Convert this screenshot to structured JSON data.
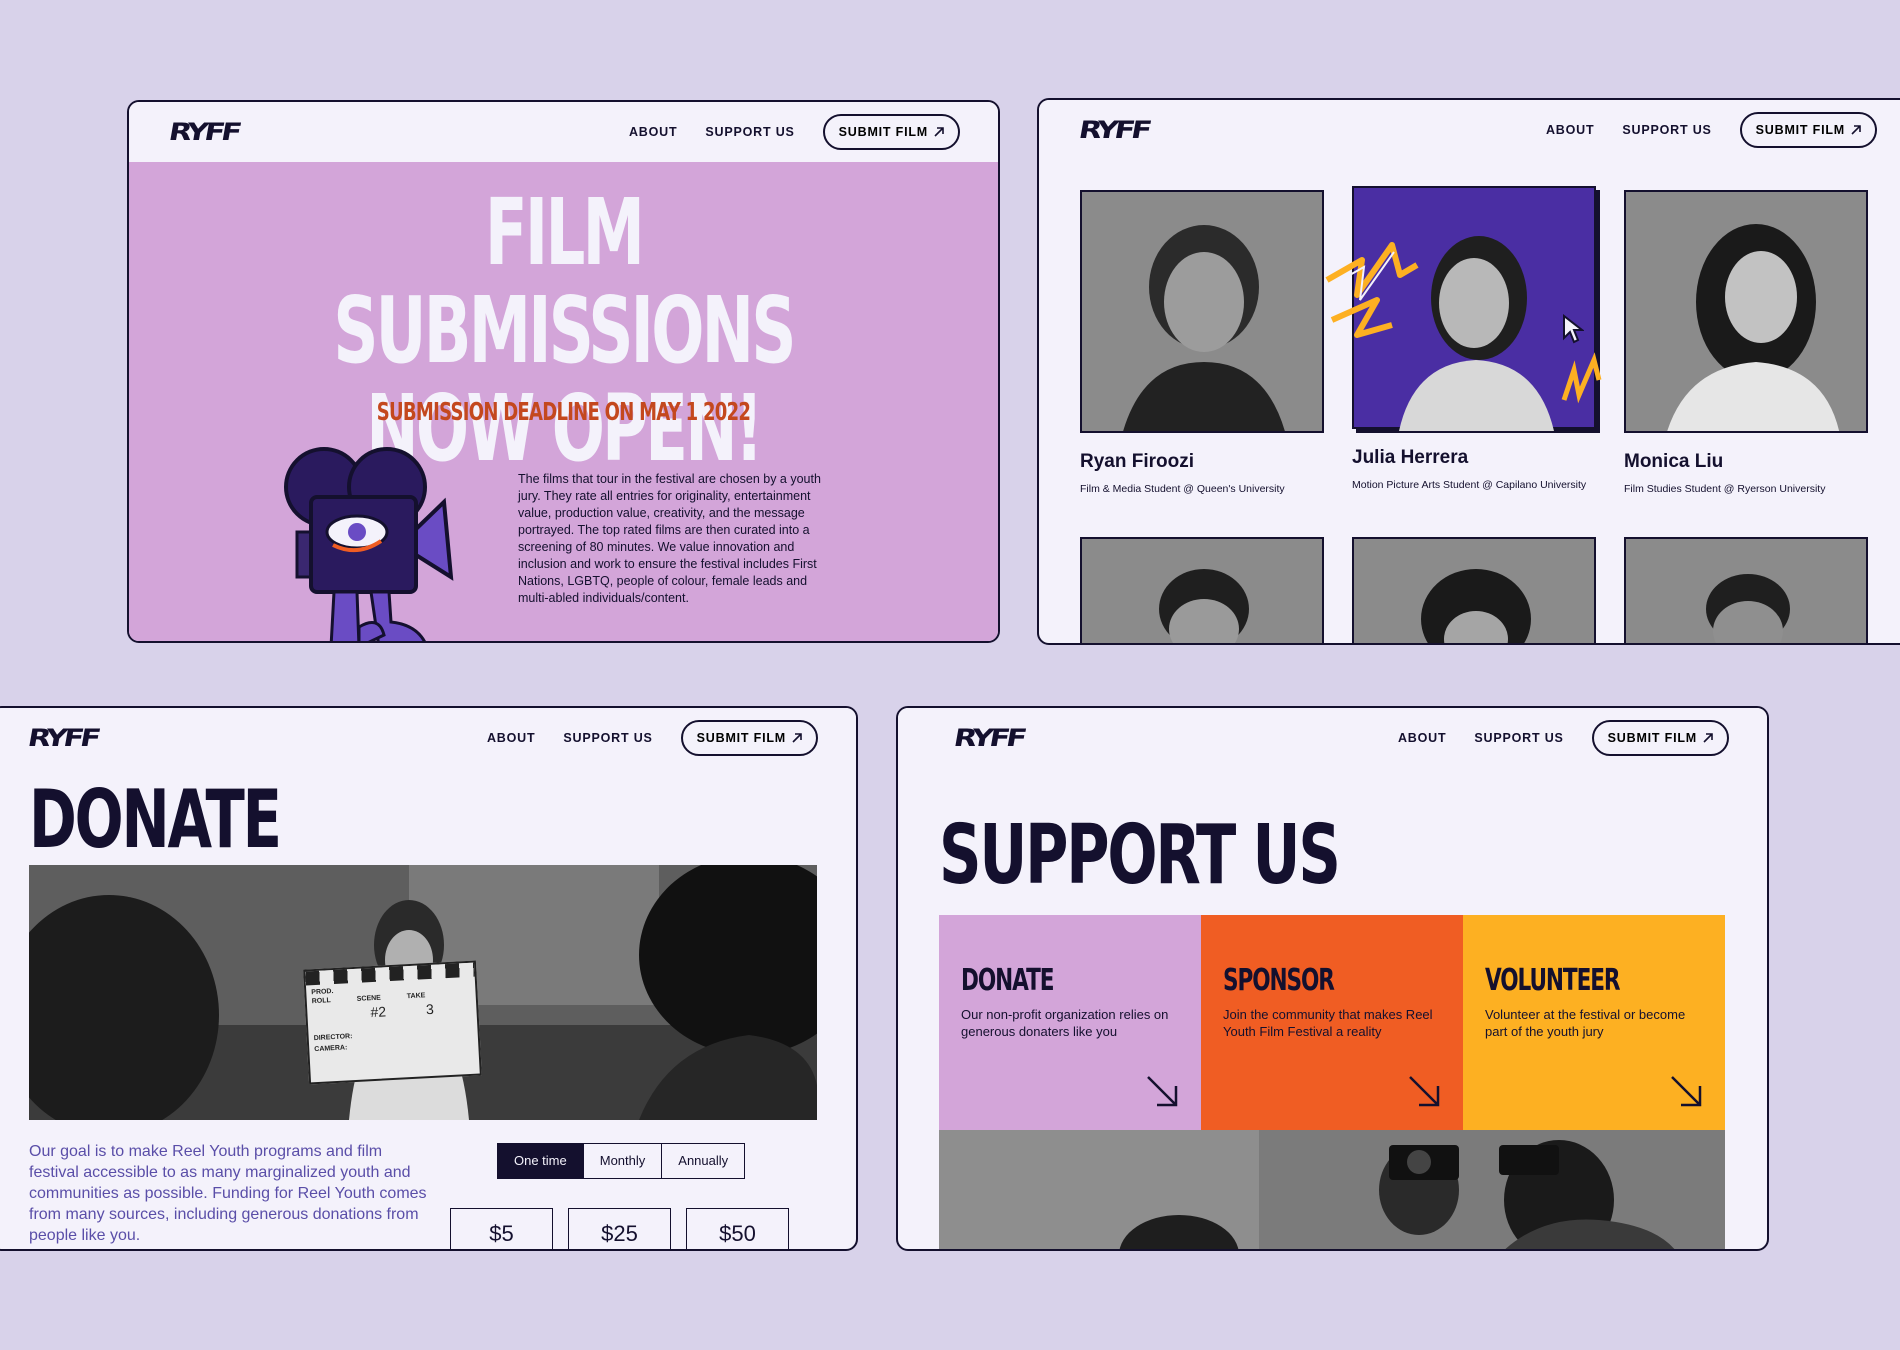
{
  "nav": {
    "logo": "RYFF",
    "about": "ABOUT",
    "support": "SUPPORT US",
    "submit": "SUBMIT FILM"
  },
  "submissions": {
    "title_line1": "FILM SUBMISSIONS",
    "title_line2": "NOW OPEN!",
    "deadline": "SUBMISSION DEADLINE ON MAY 1 2022",
    "body": "The films that tour in the festival are chosen by a youth jury. They rate all entries for originality, entertainment value, production value, creativity, and the message portrayed. The top rated films are then curated into a screening of 80 minutes. We value innovation and inclusion and work to ensure the festival includes First Nations, LGBTQ, people of colour, female leads and multi-abled individuals/content."
  },
  "jury": [
    {
      "name": "Ryan Firoozi",
      "role": "Film & Media Student @ Queen's University"
    },
    {
      "name": "Julia Herrera",
      "role": "Motion Picture Arts Student @ Capilano University"
    },
    {
      "name": "Monica Liu",
      "role": "Film Studies Student @ Ryerson University"
    }
  ],
  "donate": {
    "title": "DONATE",
    "text": "Our goal is to make Reel Youth programs and film festival accessible to as many marginalized youth and communities as possible. Funding for Reel Youth comes from many sources, including generous donations from people like you.",
    "frequency": [
      "One time",
      "Monthly",
      "Annually"
    ],
    "amounts": [
      "$5",
      "$25",
      "$50"
    ],
    "slate": {
      "prod": "PROD.",
      "roll": "ROLL",
      "scene": "SCENE",
      "take": "TAKE",
      "scene_val": "#2",
      "take_val": "3",
      "director": "DIRECTOR:",
      "camera": "CAMERA:"
    }
  },
  "support": {
    "title": "SUPPORT US",
    "cards": [
      {
        "title": "DONATE",
        "text": "Our non-profit organization relies on generous donaters like you",
        "color": "#d3a5d9"
      },
      {
        "title": "SPONSOR",
        "text": "Join the community that makes Reel Youth Film Festival a reality",
        "color": "#f05d23"
      },
      {
        "title": "VOLUNTEER",
        "text": "Volunteer at the festival or become part of the youth jury",
        "color": "#fdb022"
      }
    ]
  },
  "colors": {
    "background": "#d8d2ea",
    "panel": "#f4f2fb",
    "ink": "#14102e",
    "lilac": "#d3a5d9",
    "accent_orange": "#c4481e",
    "purple": "#4a2ea3"
  }
}
